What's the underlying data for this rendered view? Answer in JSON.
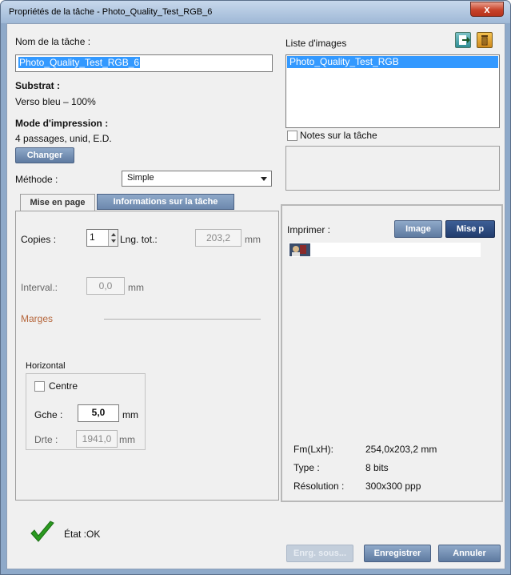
{
  "window": {
    "title": "Propriétés de la tâche - Photo_Quality_Test_RGB_6",
    "close": "x"
  },
  "left": {
    "task_name_label": "Nom de la tâche :",
    "task_name_value": "Photo_Quality_Test_RGB_6",
    "substrate_label": "Substrat :",
    "substrate_value": "Verso bleu – 100%",
    "print_mode_label": "Mode d'impression :",
    "print_mode_value": "4 passages, unid, E.D.",
    "change_button": "Changer",
    "method_label": "Méthode :",
    "method_value": "Simple"
  },
  "tabs": [
    {
      "label": "Mise en page"
    },
    {
      "label": "Informations sur la tâche"
    }
  ],
  "layout": {
    "copies_label": "Copies :",
    "copies_value": "1",
    "total_length_label": "Lng. tot.:",
    "total_length_value": "203,2",
    "unit_mm": "mm",
    "interval_label": "Interval.:",
    "interval_value": "0,0",
    "margins_label": "Marges",
    "horizontal_label": "Horizontal",
    "center_label": "Centre",
    "left_label": "Gche :",
    "left_value": "5,0",
    "right_label": "Drte :",
    "right_value": "1941,0"
  },
  "right": {
    "image_list_label": "Liste d'images",
    "image_list_items": [
      "Photo_Quality_Test_RGB"
    ],
    "notes_label": "Notes sur la tâche",
    "print_label": "Imprimer :",
    "image_button": "Image",
    "layout_button": "Mise p",
    "size_label": "Fm(LxH):",
    "size_value": "254,0x203,2 mm",
    "type_label": "Type :",
    "type_value": "8 bits",
    "resolution_label": "Résolution :",
    "resolution_value": "300x300 ppp"
  },
  "footer": {
    "status": "État :OK",
    "save_as": "Enrg. sous...",
    "save": "Enregistrer",
    "cancel": "Annuler"
  },
  "colors": {
    "accent": "#5e7aa0",
    "selection": "#3399ff",
    "ok_check": "#2a9a1f",
    "margins_label": "#b5653a"
  },
  "icons": [
    "add-image-icon",
    "delete-icon",
    "dropdown-arrow-icon",
    "spinner-icon",
    "image-thumbnail-icon",
    "checkmark-icon"
  ]
}
